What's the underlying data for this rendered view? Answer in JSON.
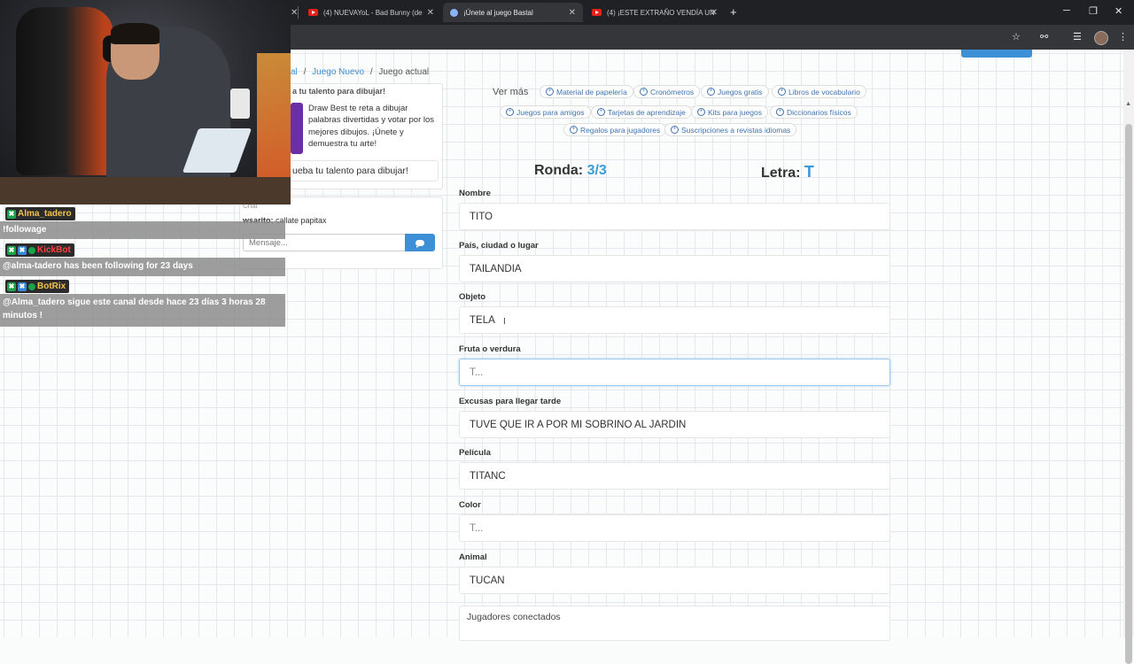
{
  "browser": {
    "tabs": [
      {
        "title": "(4) NUEVAYoL - Bad Bunny (de",
        "icon": "youtube-icon"
      },
      {
        "title": "¡Únete al juego Bastal",
        "icon": "globe-icon"
      },
      {
        "title": "(4) ¡ESTE EXTRAÑO VENDÍA UN",
        "icon": "youtube-icon"
      }
    ],
    "new_tab": "+",
    "win_min": "─",
    "win_max": "❐",
    "win_close": "✕"
  },
  "breadcrumb": {
    "first": "al",
    "second": "Juego Nuevo",
    "current": "Juego actual",
    "sep": "/"
  },
  "promo": {
    "title": "a tu talento para dibujar!",
    "text": "Draw Best te reta a dibujar palabras divertidas y votar por los mejores dibujos. ¡Únete y demuestra tu arte!",
    "button": "ueba tu talento para dibujar!"
  },
  "chat": {
    "title": "Chat",
    "user": "wsarito:",
    "message": " callate papitax",
    "input_placeholder": "Mensaje..."
  },
  "stream_chat": [
    {
      "nick": "Alma_tadero",
      "nick_color": "#f3c34b",
      "text": "!followage"
    },
    {
      "nick": "KickBot",
      "nick_color": "#ff4040",
      "text": "@alma-tadero has been following for 23 days"
    },
    {
      "nick": "BotRix",
      "nick_color": "#f3c34b",
      "text": "@Alma_tadero sigue este canal desde hace 23 días 3 horas 28 minutos !"
    }
  ],
  "links": {
    "ver_mas": "Ver más",
    "chips": [
      "Material de papelería",
      "Cronómetros",
      "Juegos gratis",
      "Libros de vocabulario",
      "Juegos para amigos",
      "Tarjetas de aprendizaje",
      "Kits para juegos",
      "Diccionarios físicos",
      "Regalos para jugadores",
      "Suscripciones a revistas idiomas"
    ]
  },
  "game": {
    "ronda_label": "Ronda:",
    "ronda_value": "3/3",
    "letra_label": "Letra:",
    "letra_value": "T",
    "fields": [
      {
        "label": "Nombre",
        "value": "TITO",
        "placeholder": "T..."
      },
      {
        "label": "País, ciudad o lugar",
        "value": "TAILANDIA",
        "placeholder": "T..."
      },
      {
        "label": "Objeto",
        "value": "TELA",
        "placeholder": "T..."
      },
      {
        "label": "Fruta o verdura",
        "value": "",
        "placeholder": "T..."
      },
      {
        "label": "Excusas para llegar tarde",
        "value": "TUVE QUE IR A POR MI SOBRINO AL JARDIN",
        "placeholder": "T..."
      },
      {
        "label": "Película",
        "value": "TITANC",
        "placeholder": "T..."
      },
      {
        "label": "Color",
        "value": "",
        "placeholder": "T..."
      },
      {
        "label": "Animal",
        "value": "TUCÁN",
        "placeholder": "T..."
      }
    ],
    "players_title": "Jugadores conectados"
  },
  "colors": {
    "accent": "#3d8fd6",
    "highlight": "#3d9ad6"
  }
}
